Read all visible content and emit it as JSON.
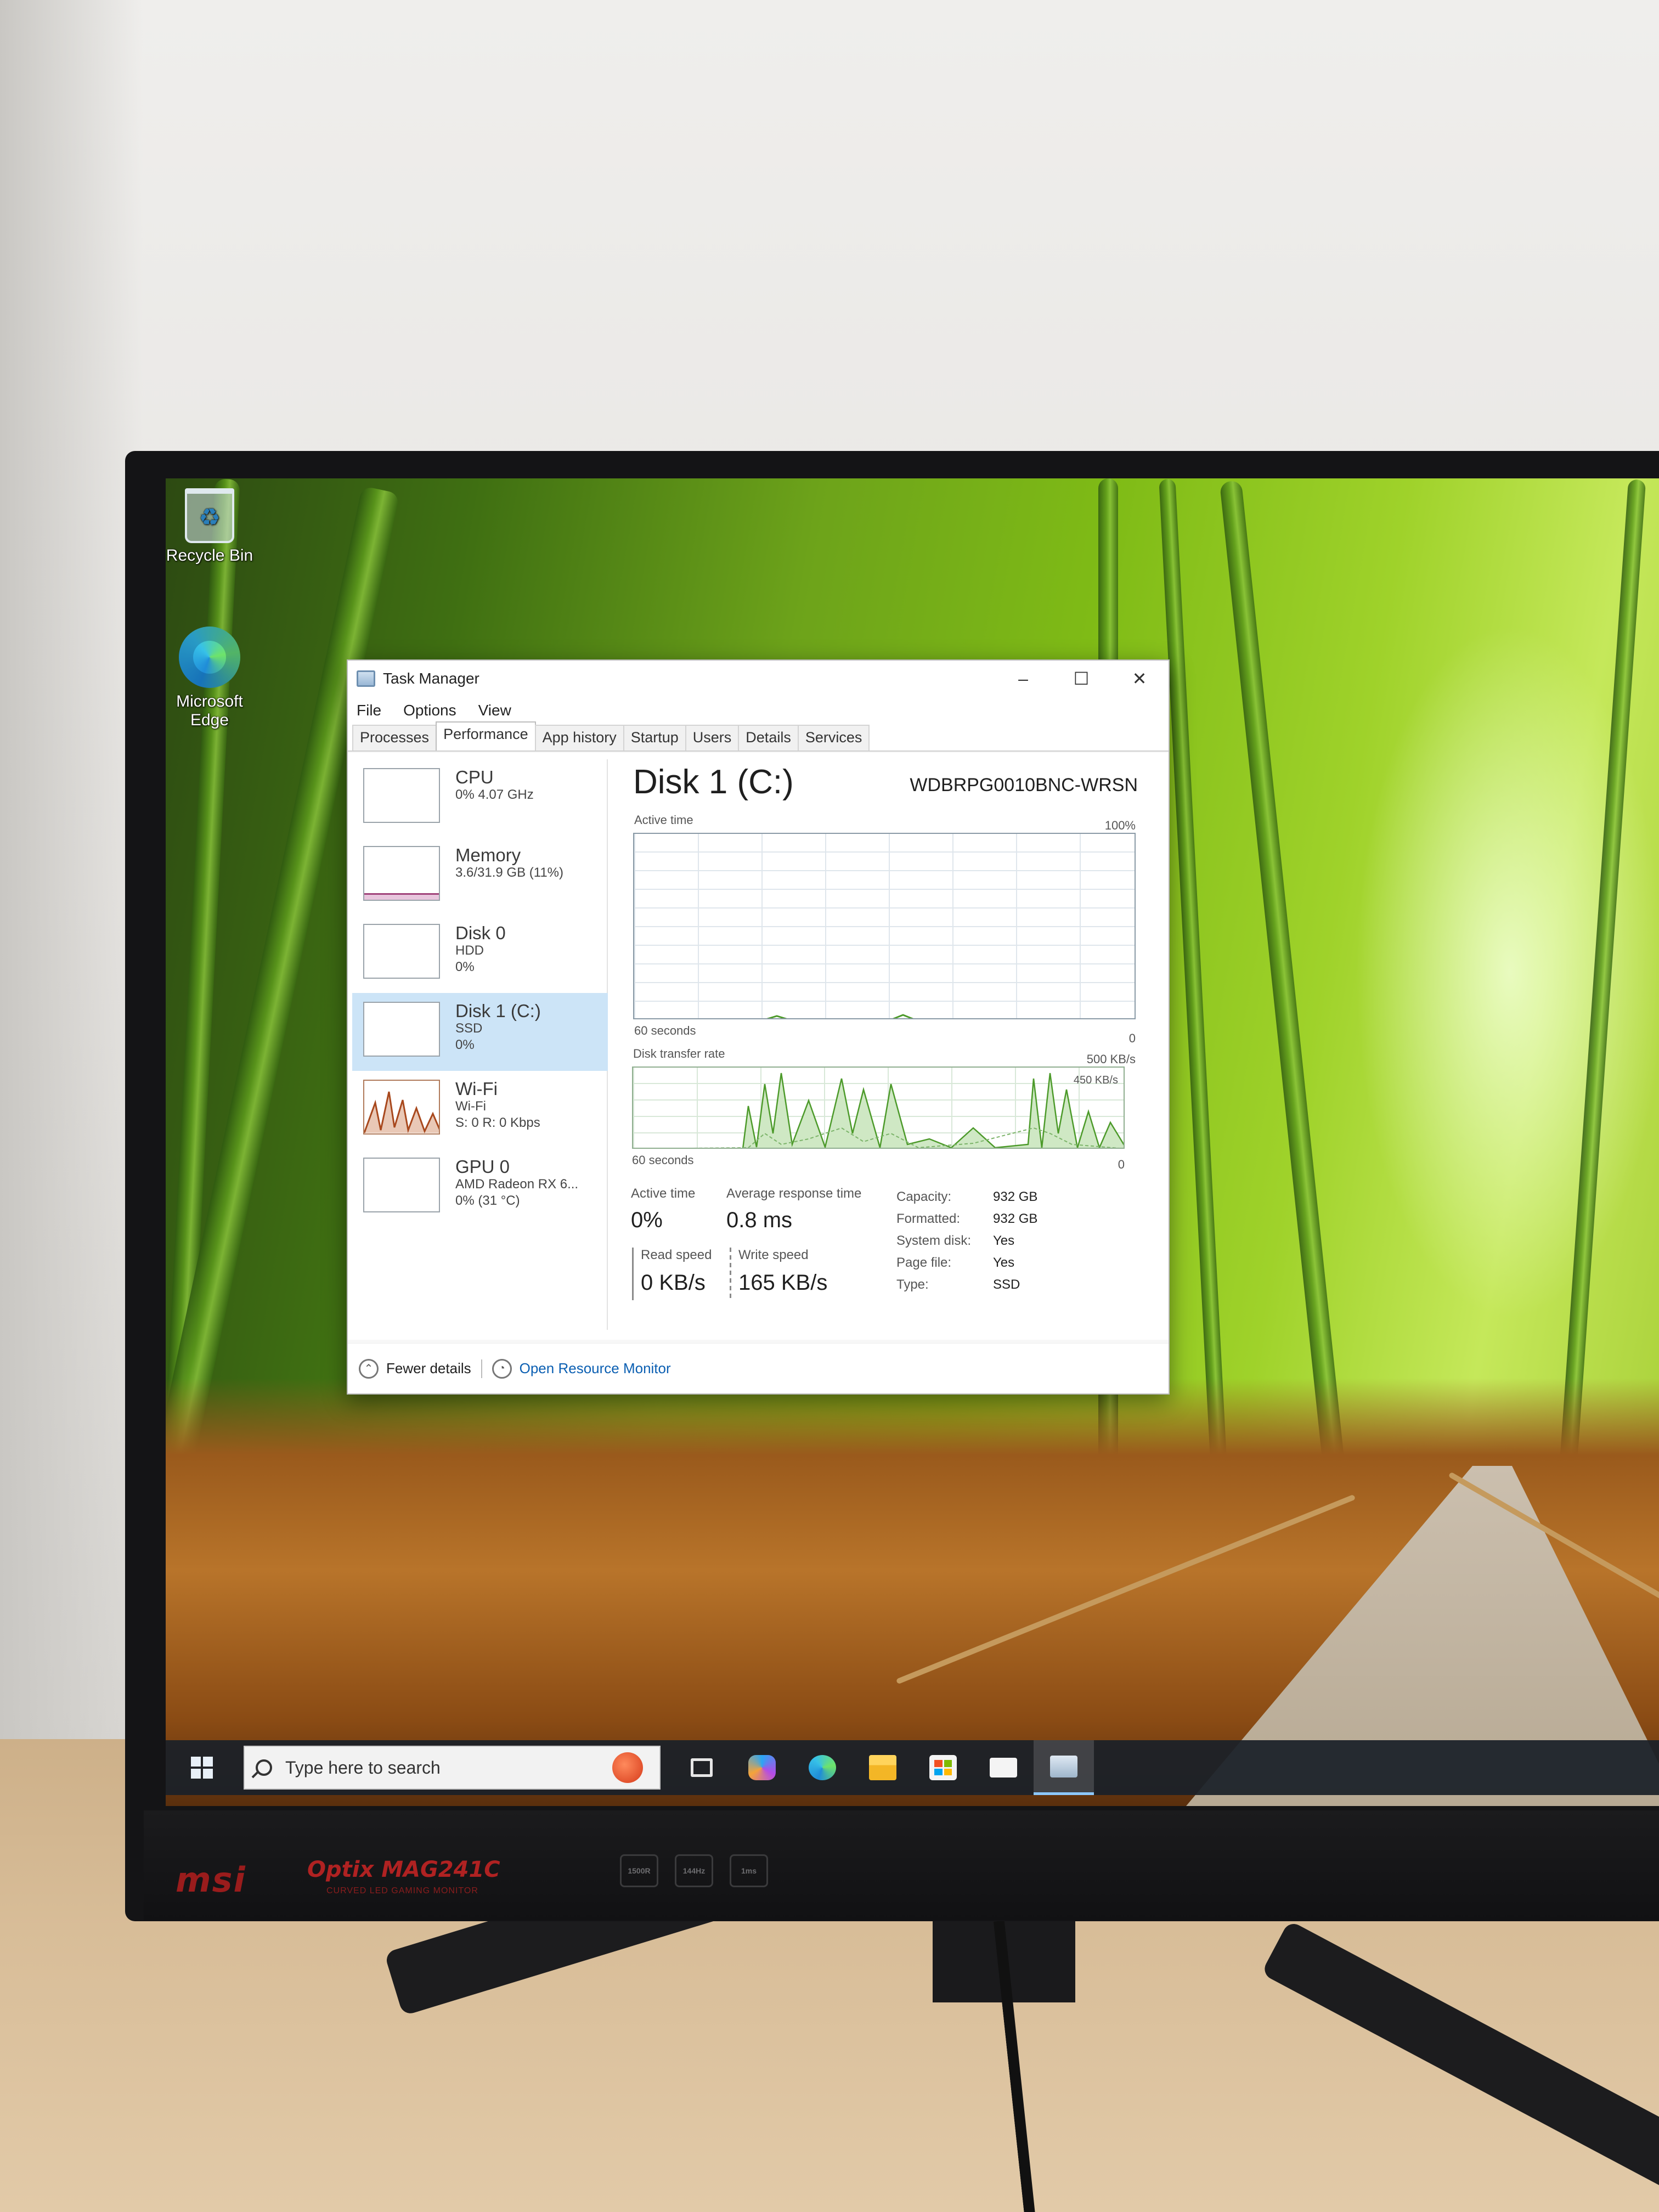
{
  "monitor": {
    "brand": "msi",
    "model": "Optix MAG241C",
    "model_sub": "CURVED LED GAMING MONITOR",
    "badges": [
      "1500R",
      "144Hz",
      "1ms"
    ]
  },
  "desktop": {
    "icons": [
      {
        "label": "Recycle Bin",
        "icon": "recycle-bin-icon"
      },
      {
        "label": "Microsoft Edge",
        "icon": "edge-icon"
      }
    ]
  },
  "window": {
    "title": "Task Manager",
    "controls": {
      "minimize": "–",
      "maximize": "☐",
      "close": "✕"
    },
    "menu": [
      "File",
      "Options",
      "View"
    ],
    "tabs": [
      "Processes",
      "Performance",
      "App history",
      "Startup",
      "Users",
      "Details",
      "Services"
    ],
    "active_tab": "Performance"
  },
  "sidebar": {
    "items": [
      {
        "title": "CPU",
        "line1": "0% 4.07 GHz",
        "line2": ""
      },
      {
        "title": "Memory",
        "line1": "3.6/31.9 GB (11%)",
        "line2": ""
      },
      {
        "title": "Disk 0",
        "line1": "HDD",
        "line2": "0%"
      },
      {
        "title": "Disk 1 (C:)",
        "line1": "SSD",
        "line2": "0%"
      },
      {
        "title": "Wi-Fi",
        "line1": "Wi-Fi",
        "line2": "S: 0 R: 0 Kbps"
      },
      {
        "title": "GPU 0",
        "line1": "AMD Radeon RX 6...",
        "line2": "0% (31 °C)"
      }
    ],
    "selected_index": 3
  },
  "detail": {
    "title": "Disk 1 (C:)",
    "model": "WDBRPG0010BNC-WRSN",
    "graph1": {
      "label": "Active time",
      "max": "100%",
      "time": "60 seconds",
      "min": "0"
    },
    "graph2": {
      "label": "Disk transfer rate",
      "max": "500 KB/s",
      "inner": "450 KB/s",
      "time": "60 seconds",
      "min": "0"
    },
    "stats": {
      "active_time_label": "Active time",
      "active_time": "0%",
      "avg_resp_label": "Average response time",
      "avg_resp": "0.8 ms",
      "read_label": "Read speed",
      "read": "0 KB/s",
      "write_label": "Write speed",
      "write": "165 KB/s"
    },
    "props": {
      "capacity_key": "Capacity:",
      "capacity": "932 GB",
      "formatted_key": "Formatted:",
      "formatted": "932 GB",
      "system_key": "System disk:",
      "system": "Yes",
      "page_key": "Page file:",
      "page": "Yes",
      "type_key": "Type:",
      "type": "SSD"
    }
  },
  "footer": {
    "fewer": "Fewer details",
    "resource": "Open Resource Monitor"
  },
  "taskbar": {
    "search_placeholder": "Type here to search",
    "apps": [
      "task-view-icon",
      "copilot-icon",
      "edge-icon",
      "file-explorer-icon",
      "store-icon",
      "mail-icon",
      "task-manager-icon"
    ]
  },
  "colors": {
    "selection": "#cce4f7",
    "disk_graph": "#4c9a2a",
    "link": "#0b5fb2"
  }
}
